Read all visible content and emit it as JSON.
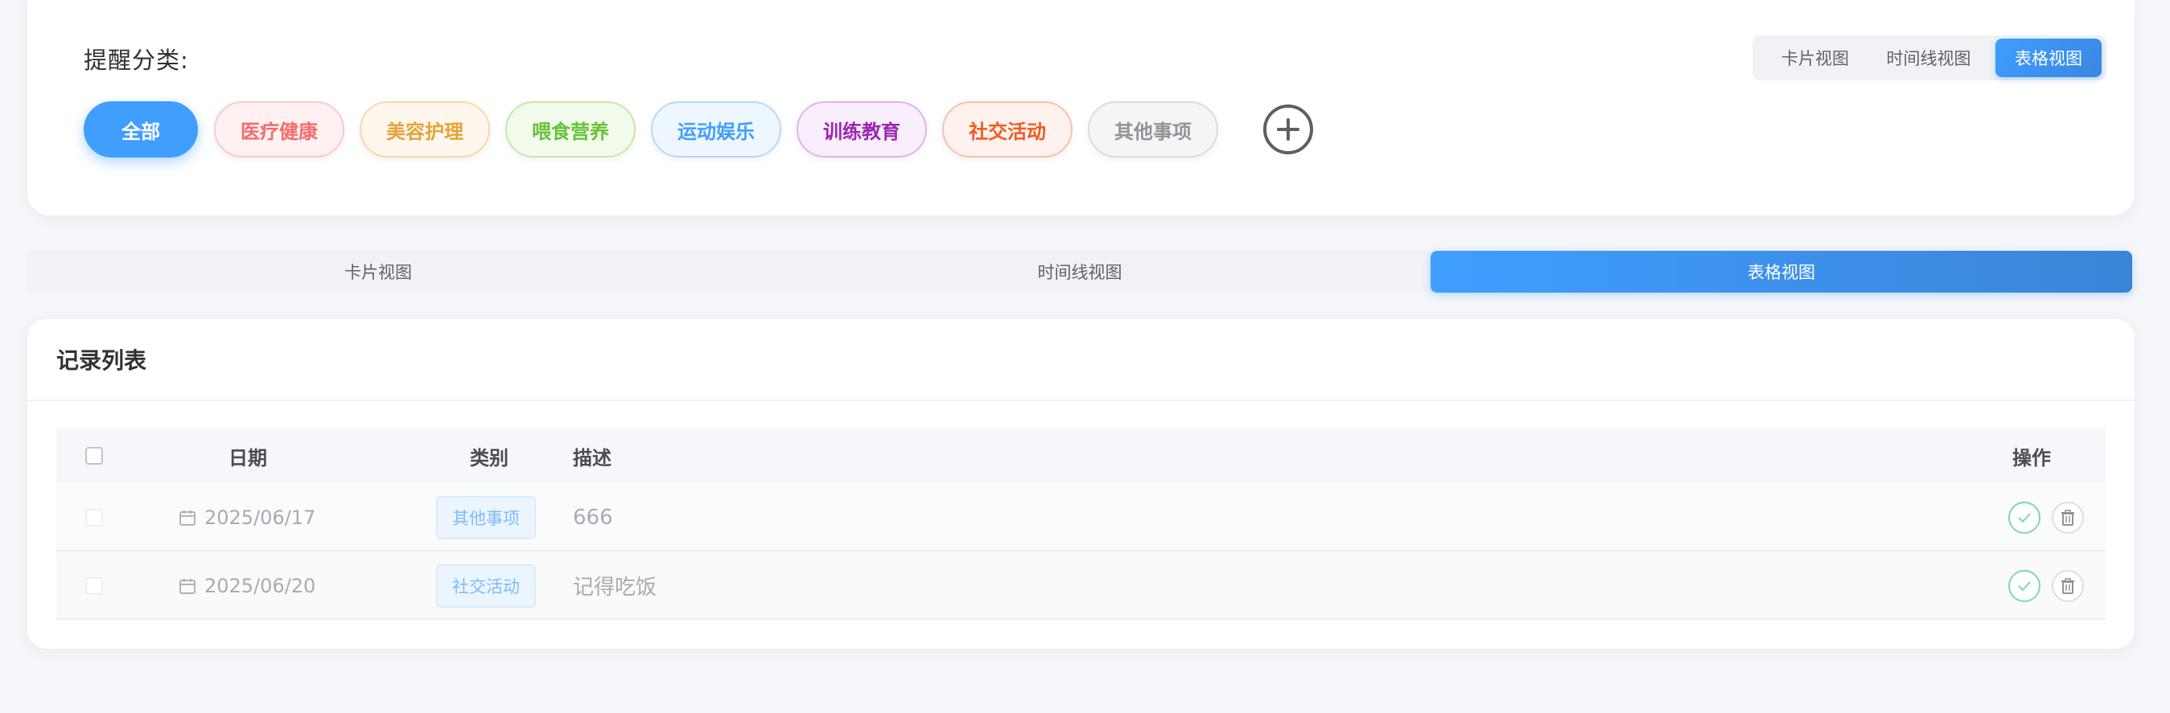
{
  "filter": {
    "label": "提醒分类:",
    "mini_views": [
      "卡片视图",
      "时间线视图",
      "表格视图"
    ],
    "active_mini_view": 2,
    "tags": [
      {
        "label": "全部",
        "key": "all",
        "active": true
      },
      {
        "label": "医疗健康",
        "key": "medical"
      },
      {
        "label": "美容护理",
        "key": "beauty"
      },
      {
        "label": "喂食营养",
        "key": "food"
      },
      {
        "label": "运动娱乐",
        "key": "sport"
      },
      {
        "label": "训练教育",
        "key": "train"
      },
      {
        "label": "社交活动",
        "key": "social"
      },
      {
        "label": "其他事项",
        "key": "other"
      }
    ],
    "add_icon": "plus-circle-icon"
  },
  "views": {
    "items": [
      "卡片视图",
      "时间线视图",
      "表格视图"
    ],
    "active": 2
  },
  "records": {
    "title": "记录列表",
    "columns": {
      "date": "日期",
      "category": "类别",
      "description": "描述",
      "actions": "操作"
    },
    "rows": [
      {
        "date": "2025/06/17",
        "category": "其他事项",
        "description": "666"
      },
      {
        "date": "2025/06/20",
        "category": "社交活动",
        "description": "记得吃饭"
      }
    ]
  },
  "colors": {
    "primary": "#409eff",
    "success": "#67c23a",
    "danger": "#f56c6c",
    "warning": "#e6a23c"
  }
}
